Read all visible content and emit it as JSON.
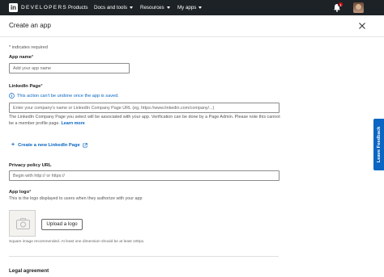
{
  "nav": {
    "brand_mark": "in",
    "brand_text": "DEVELOPERS",
    "products": "Products",
    "docs": "Docs and tools",
    "resources": "Resources",
    "my_apps": "My apps",
    "notification_count": "1",
    "icons": [
      "bell-icon",
      "chevron-down-icon",
      "avatar"
    ]
  },
  "header": {
    "title": "Create an app",
    "close_icon": "close-icon"
  },
  "form": {
    "required_note": "* indicates required",
    "app_name": {
      "label": "App name",
      "required_mark": "*",
      "placeholder": "Add your app name"
    },
    "linkedin_page": {
      "label": "LinkedIn Page",
      "required_mark": "*",
      "warning": "This action can't be undone once the app is saved.",
      "placeholder": "Enter your company's name or LinkedIn Company Page URL (eg, https://www.linkedin.com/company/...)",
      "help_text": "The LinkedIn Company Page you select will be associated with your app. Verification can be done by a Page Admin. Please note this cannot be a member profile page.",
      "learn_more": "Learn more",
      "create_link": "Create a new LinkedIn Page"
    },
    "privacy_policy": {
      "label": "Privacy policy URL",
      "placeholder": "Begin with http:// or https://"
    },
    "app_logo": {
      "label": "App logo",
      "required_mark": "*",
      "help_text": "This is the logo displayed to users when they authorize with your app",
      "upload_button": "Upload a logo",
      "size_note": "Square image recommended. At least one dimension should be at least 100px."
    },
    "legal_title": "Legal agreement"
  },
  "feedback": {
    "label": "Leave Feedback"
  },
  "colors": {
    "nav_bg": "#1d2226",
    "accent": "#0a66c2",
    "badge": "#cc1016"
  }
}
